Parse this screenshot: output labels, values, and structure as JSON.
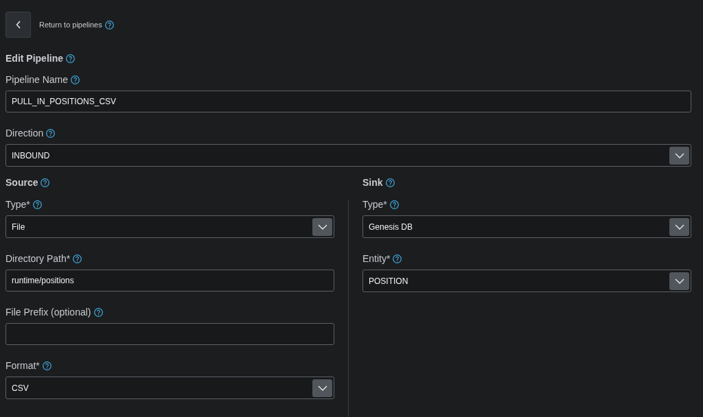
{
  "back_link": {
    "label": "Return to pipelines"
  },
  "title": "Edit Pipeline",
  "fields": [
    {
      "kind": "text",
      "label": "Pipeline Name",
      "value": "PULL_IN_POSITIONS_CSV"
    },
    {
      "kind": "select",
      "label": "Direction",
      "value": "INBOUND"
    }
  ],
  "source": {
    "heading": "Source",
    "fields": [
      {
        "kind": "select",
        "label": "Type*",
        "value": "File"
      },
      {
        "kind": "text",
        "label": "Directory Path*",
        "value": "runtime/positions"
      },
      {
        "kind": "text",
        "label": "File Prefix (optional)"
      },
      {
        "kind": "select",
        "label": "Format*",
        "value": "CSV"
      }
    ]
  },
  "sink": {
    "heading": "Sink",
    "fields": [
      {
        "kind": "select",
        "label": "Type*",
        "value": "Genesis DB"
      },
      {
        "kind": "select",
        "label": "Entity*",
        "value": "POSITION"
      }
    ]
  }
}
